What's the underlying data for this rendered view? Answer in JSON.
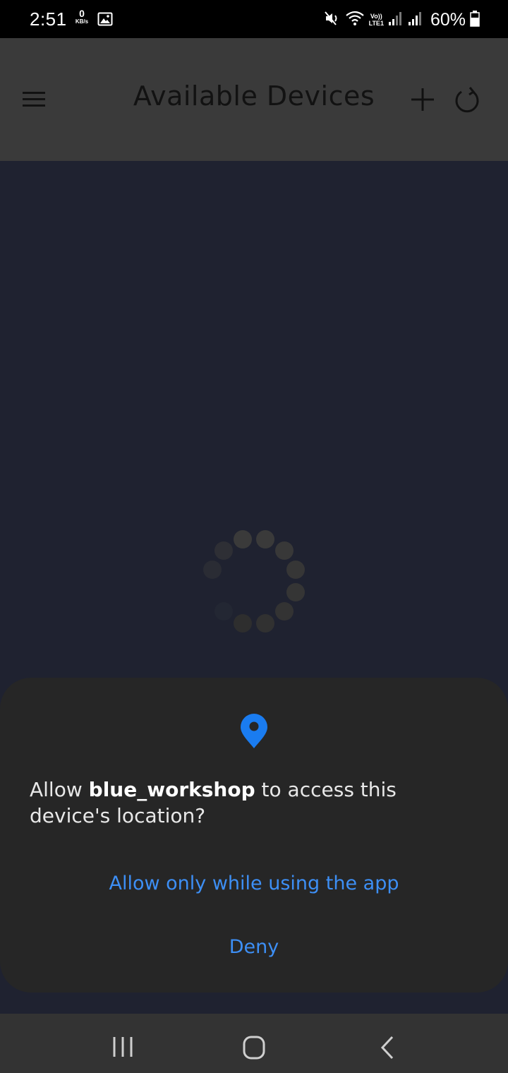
{
  "status_bar": {
    "time": "2:51",
    "net_speed_value": "0",
    "net_speed_unit": "KB/s",
    "volte_top": "Vo))",
    "volte_bottom": "LTE1",
    "battery": "60%",
    "icons": [
      "gallery-icon",
      "mute-icon",
      "wifi-icon",
      "signal-icon",
      "signal-icon",
      "battery-icon"
    ]
  },
  "app_bar": {
    "title": "Available Devices",
    "icons": [
      "menu-icon",
      "plus-icon",
      "refresh-icon"
    ]
  },
  "dialog": {
    "icon": "location-pin-icon",
    "accent": "#1a7cf0",
    "message_prefix": "Allow ",
    "app_name": "blue_workshop",
    "message_suffix": " to access this device's location?",
    "allow_label": "Allow only while using the app",
    "deny_label": "Deny",
    "button_color": "#3d8ff5"
  },
  "nav_bar": {
    "icons": [
      "recent-apps-icon",
      "home-icon",
      "back-icon"
    ]
  },
  "colors": {
    "background": "#1f2230",
    "app_bar": "#3a3a3a",
    "dialog": "#262626",
    "nav_bar": "#333333"
  }
}
